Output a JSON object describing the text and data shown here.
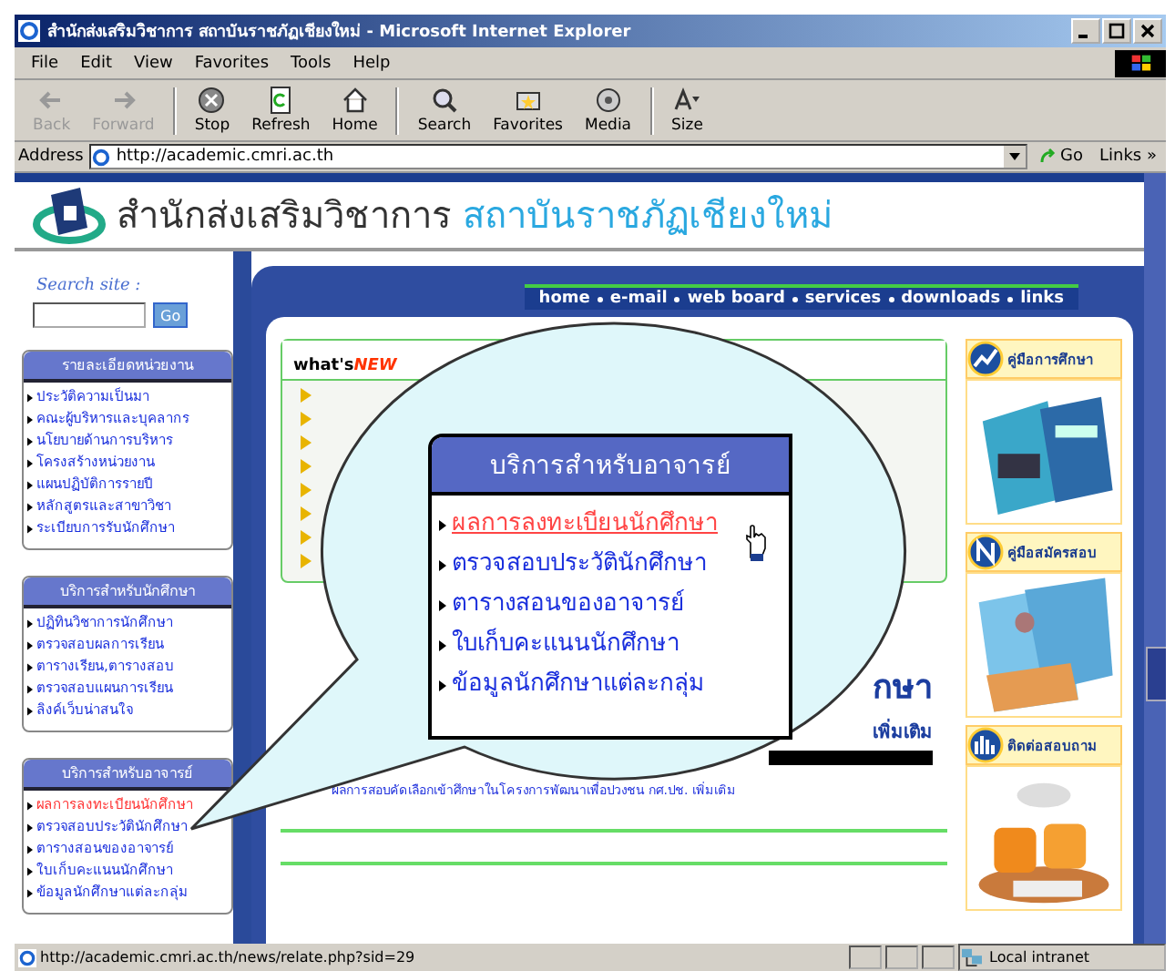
{
  "window": {
    "title": "สำนักส่งเสริมวิชาการ สถาบันราชภัฏเชียงใหม่ - Microsoft Internet Explorer"
  },
  "menu": [
    "File",
    "Edit",
    "View",
    "Favorites",
    "Tools",
    "Help"
  ],
  "toolbar": [
    {
      "label": "Back",
      "kind": "back",
      "disabled": true
    },
    {
      "label": "Forward",
      "kind": "forward",
      "disabled": true
    },
    {
      "label": "Stop",
      "kind": "stop",
      "disabled": false
    },
    {
      "label": "Refresh",
      "kind": "refresh",
      "disabled": false
    },
    {
      "label": "Home",
      "kind": "home",
      "disabled": false
    },
    {
      "label": "Search",
      "kind": "search",
      "disabled": false
    },
    {
      "label": "Favorites",
      "kind": "favorites",
      "disabled": false
    },
    {
      "label": "Media",
      "kind": "media",
      "disabled": false
    },
    {
      "label": "Size",
      "kind": "size",
      "disabled": false
    }
  ],
  "address": {
    "label": "Address",
    "url": "http://academic.cmri.ac.th",
    "go": "Go",
    "links": "Links",
    "links_more": "»"
  },
  "site": {
    "org": "สำนักส่งเสริมวิชาการ",
    "institute": "สถาบันราชภัฏเชียงใหม่"
  },
  "search": {
    "label": "Search site :",
    "button": "Go"
  },
  "sidebar": [
    {
      "title": "รายละเอียดหน่วยงาน",
      "items": [
        {
          "label": "ประวัติความเป็นมา",
          "selected": false
        },
        {
          "label": "คณะผู้บริหารและบุคลากร",
          "selected": false
        },
        {
          "label": "นโยบายด้านการบริหาร",
          "selected": false
        },
        {
          "label": "โครงสร้างหน่วยงาน",
          "selected": false
        },
        {
          "label": "แผนปฏิบัติการรายปี",
          "selected": false
        },
        {
          "label": "หลักสูตรและสาขาวิชา",
          "selected": false
        },
        {
          "label": "ระเบียบการรับนักศึกษา",
          "selected": false
        }
      ]
    },
    {
      "title": "บริการสำหรับนักศึกษา",
      "items": [
        {
          "label": "ปฏิทินวิชาการนักศึกษา",
          "selected": false
        },
        {
          "label": "ตรวจสอบผลการเรียน",
          "selected": false
        },
        {
          "label": "ตารางเรียน,ตารางสอบ",
          "selected": false
        },
        {
          "label": "ตรวจสอบแผนการเรียน",
          "selected": false
        },
        {
          "label": "ลิงค์เว็บน่าสนใจ",
          "selected": false
        }
      ]
    },
    {
      "title": "บริการสำหรับอาจารย์",
      "items": [
        {
          "label": "ผลการลงทะเบียนนักศึกษา",
          "selected": true
        },
        {
          "label": "ตรวจสอบประวัตินักศึกษา",
          "selected": false
        },
        {
          "label": "ตารางสอนของอาจารย์",
          "selected": false
        },
        {
          "label": "ใบเก็บคะแนนนักศึกษา",
          "selected": false
        },
        {
          "label": "ข้อมูลนักศึกษาแต่ละกลุ่ม",
          "selected": false
        }
      ]
    }
  ],
  "nav": [
    "home",
    "e-mail",
    "web board",
    "services",
    "downloads",
    "links"
  ],
  "whats_new": {
    "prefix": "what's",
    "emphasis": "NEW"
  },
  "promo": {
    "headline": "กษา",
    "subline": "เพิ่มเติม",
    "link": "ผลการสอบคัดเลือกเข้าศึกษาในโครงการพัฒนาเพื่อปวงชน กศ.ปช. เพิ่มเติม"
  },
  "right_panels": [
    {
      "title": "คู่มือการศึกษา",
      "kind": "chart"
    },
    {
      "title": "คู่มือสมัครสอบ",
      "kind": "letter"
    },
    {
      "title": "ติดต่อสอบถาม",
      "kind": "bars"
    }
  ],
  "popup": {
    "title": "บริการสำหรับอาจารย์",
    "items": [
      {
        "label": "ผลการลงทะเบียนนักศึกษา",
        "selected": true
      },
      {
        "label": "ตรวจสอบประวัตินักศึกษา",
        "selected": false
      },
      {
        "label": "ตารางสอนของอาจารย์",
        "selected": false
      },
      {
        "label": "ใบเก็บคะแนนนักศึกษา",
        "selected": false
      },
      {
        "label": "ข้อมูลนักศึกษาแต่ละกลุ่ม",
        "selected": false
      }
    ]
  },
  "status_bar": {
    "url": "http://academic.cmri.ac.th/news/relate.php?sid=29",
    "zone": "Local intranet"
  }
}
